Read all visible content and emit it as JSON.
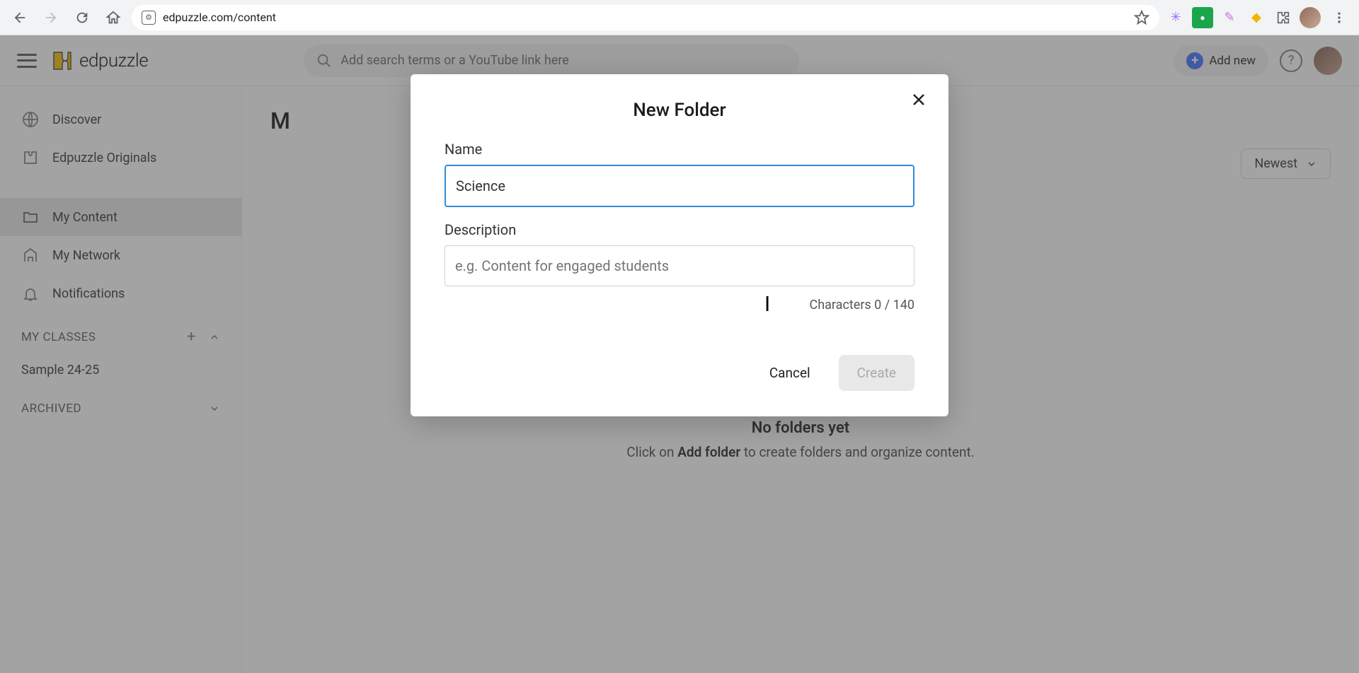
{
  "browser": {
    "url": "edpuzzle.com/content"
  },
  "header": {
    "logo_text": "edpuzzle",
    "search_placeholder": "Add search terms or a YouTube link here",
    "add_new_label": "Add new"
  },
  "sidebar": {
    "items": [
      {
        "label": "Discover"
      },
      {
        "label": "Edpuzzle Originals"
      },
      {
        "label": "My Content"
      },
      {
        "label": "My Network"
      },
      {
        "label": "Notifications"
      }
    ],
    "classes_header": "MY CLASSES",
    "classes": [
      {
        "label": "Sample 24-25"
      }
    ],
    "archived_header": "ARCHIVED"
  },
  "main": {
    "title_partial": "M",
    "sort_label": "Newest",
    "empty_title": "No folders yet",
    "empty_prefix": "Click on ",
    "empty_bold": "Add folder",
    "empty_suffix": " to create folders and organize content."
  },
  "modal": {
    "title": "New Folder",
    "name_label": "Name",
    "name_value": "Science",
    "desc_label": "Description",
    "desc_placeholder": "e.g. Content for engaged students",
    "char_count": "Characters 0 / 140",
    "cancel_label": "Cancel",
    "create_label": "Create"
  }
}
